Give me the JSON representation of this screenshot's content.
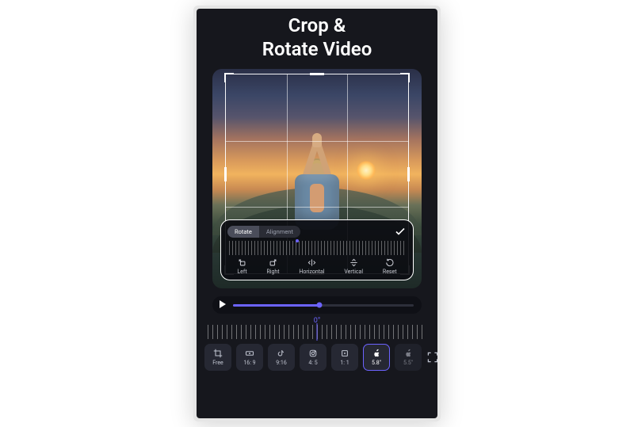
{
  "header": {
    "title_line1": "Crop &",
    "title_line2": "Rotate Video"
  },
  "rotatePanel": {
    "tabs": {
      "rotate": "Rotate",
      "alignment": "Alignment",
      "active": "rotate"
    },
    "dial": {
      "mark_percent": 38
    },
    "tools": {
      "left": "Left",
      "right": "Right",
      "horizontal": "Horizontal",
      "vertical": "Vertical",
      "reset": "Reset"
    }
  },
  "playback": {
    "progress_percent": 48
  },
  "angle": {
    "label": "0°"
  },
  "aspectRatios": [
    {
      "id": "free",
      "label": "Free",
      "icon": "crop",
      "selected": false
    },
    {
      "id": "16-9",
      "label": "16: 9",
      "icon": "rect-wide",
      "selected": false
    },
    {
      "id": "tiktok",
      "label": "9:16",
      "icon": "tiktok",
      "selected": false
    },
    {
      "id": "4-5",
      "label": "4: 5",
      "icon": "instagram",
      "selected": false
    },
    {
      "id": "1-1",
      "label": "1: 1",
      "icon": "square",
      "selected": false
    },
    {
      "id": "apple58",
      "label": "5.8\"",
      "icon": "apple",
      "selected": true
    },
    {
      "id": "apple55",
      "label": "5.5\"",
      "icon": "apple",
      "selected": false
    }
  ],
  "colors": {
    "accent": "#6c63ff"
  }
}
